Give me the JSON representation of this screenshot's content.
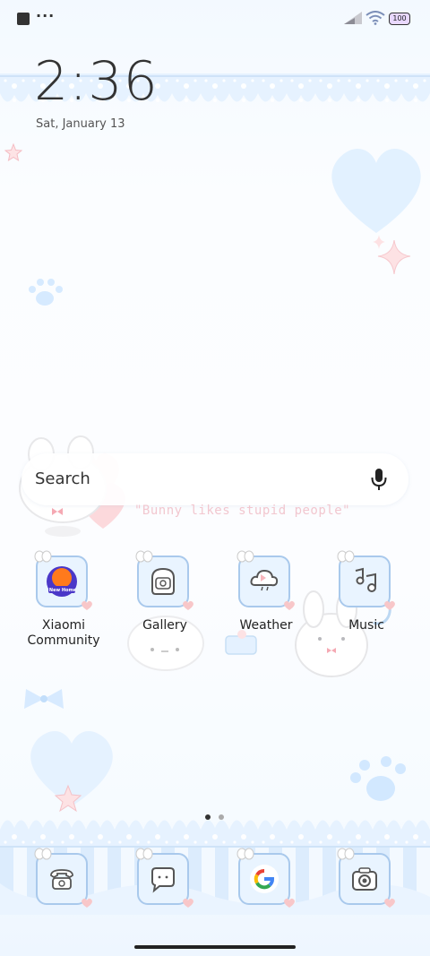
{
  "status_bar": {
    "more_indicator": "···",
    "battery_level": "100"
  },
  "lock": {
    "time": "2:36",
    "date": "Sat, January 13"
  },
  "search": {
    "label": "Search"
  },
  "decor_text": "\"Bunny likes stupid people\"",
  "apps": [
    {
      "label": "Xiaomi\nCommunity",
      "icon": "xiaomi-community-icon",
      "badge": "New Home"
    },
    {
      "label": "Gallery",
      "icon": "gallery-icon"
    },
    {
      "label": "Weather",
      "icon": "weather-icon"
    },
    {
      "label": "Music",
      "icon": "music-icon"
    }
  ],
  "dock": [
    {
      "icon": "phone-icon"
    },
    {
      "icon": "messages-icon"
    },
    {
      "icon": "google-icon"
    },
    {
      "icon": "camera-icon"
    }
  ],
  "page_indicator": {
    "pages": 2,
    "current": 1
  },
  "colors": {
    "accent_blue": "#a9c9ec",
    "tile_bg": "#e9f4ff",
    "pink": "#f8c7c9",
    "text": "#222222"
  }
}
